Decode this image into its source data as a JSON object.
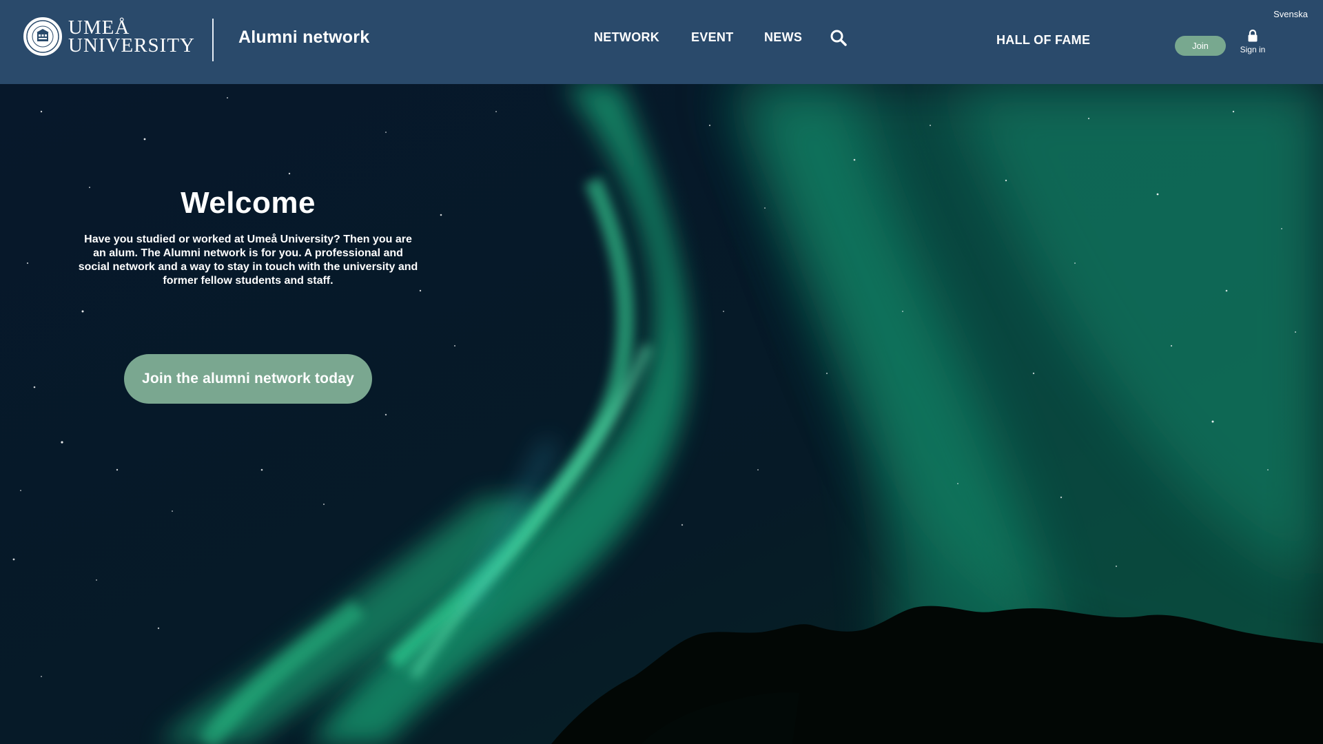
{
  "header": {
    "logo_line1": "UMEÅ",
    "logo_line2": "UNIVERSITY",
    "site_title": "Alumni network",
    "nav": {
      "network": "NETWORK",
      "event": "EVENT",
      "news": "NEWS",
      "hall_of_fame": "HALL OF FAME"
    },
    "language_link": "Svenska",
    "join_label": "Join",
    "signin_label": "Sign in",
    "icons": {
      "search": "search-icon",
      "lock": "lock-icon",
      "seal": "university-seal-icon"
    }
  },
  "hero": {
    "title": "Welcome",
    "text": "Have you studied or worked at Umeå University? Then you are an alum. The Alumni network is for you. A professional and social network and a way to stay in touch with the university and former fellow students and staff.",
    "cta_label": "Join the alumni network today"
  },
  "colors": {
    "header_bg": "#2a4a6b",
    "accent_green": "#7aa790",
    "aurora": "#1fd58f",
    "night_sky": "#061426"
  }
}
